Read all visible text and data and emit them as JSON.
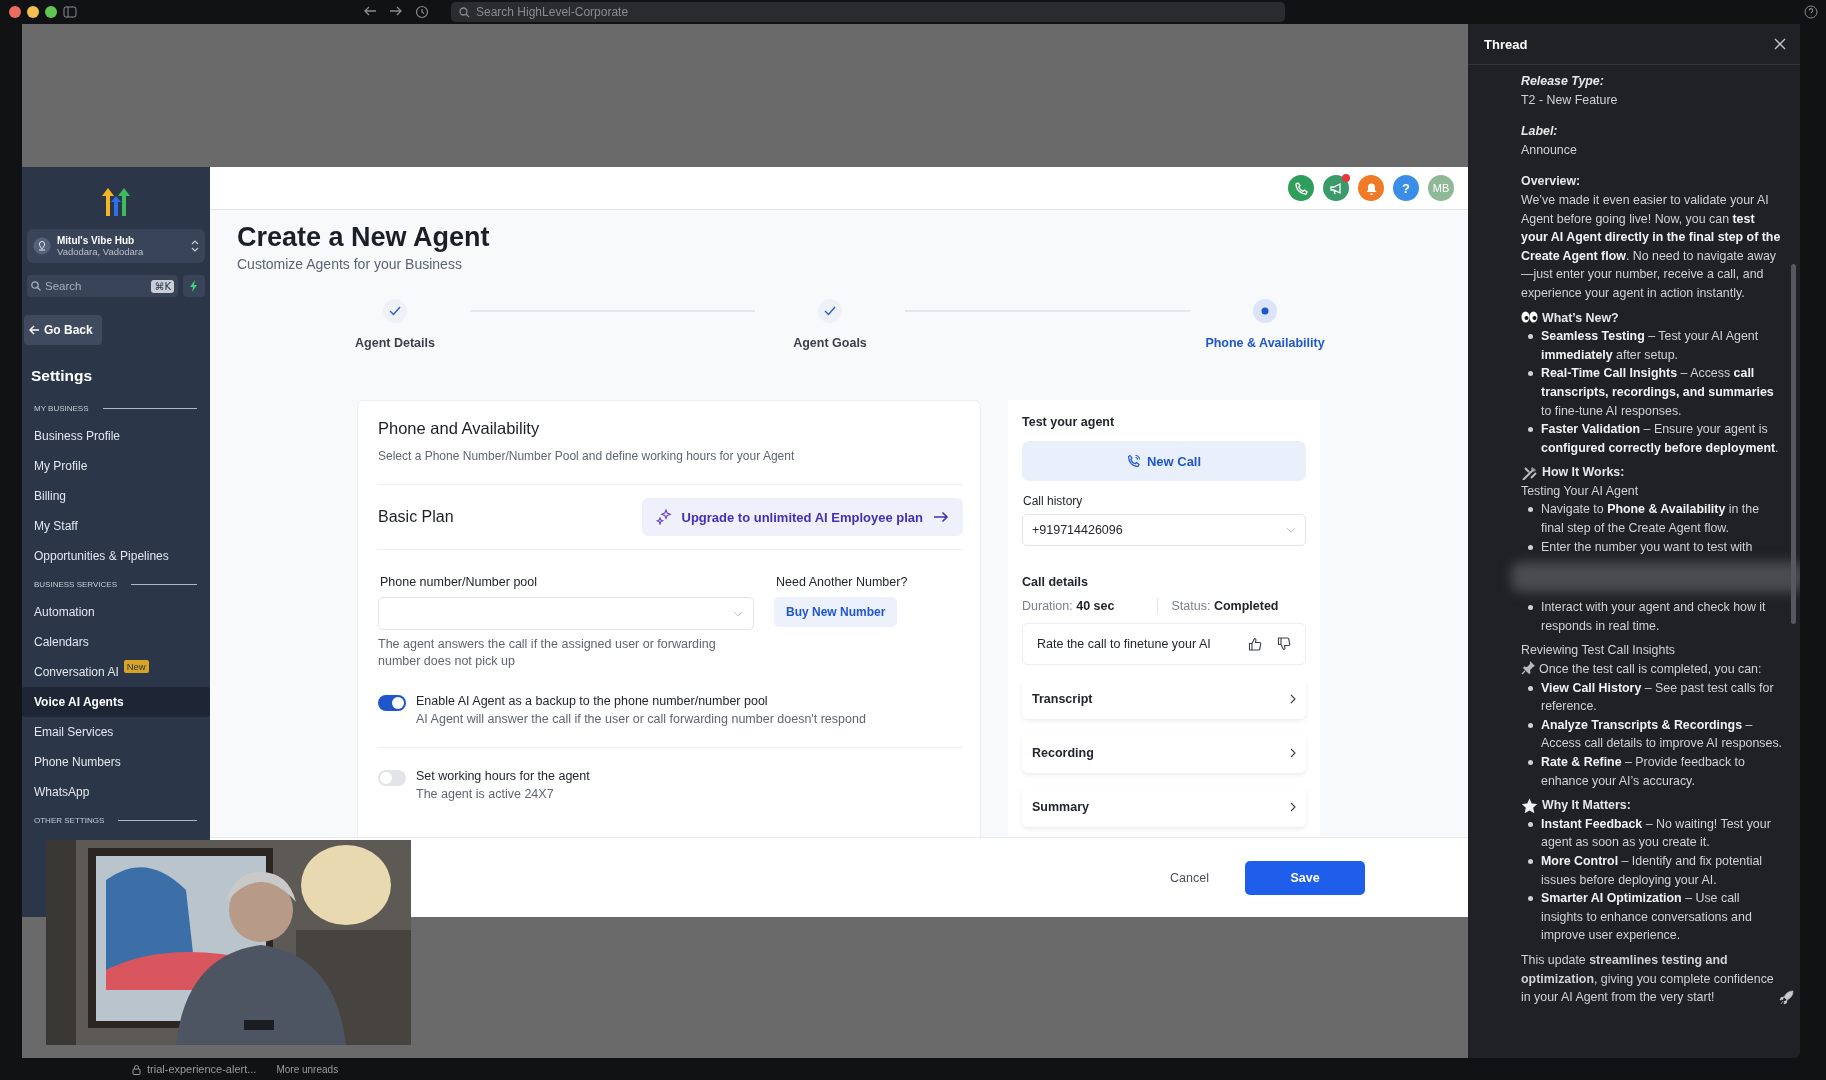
{
  "browser": {
    "search_placeholder": "Search HighLevel-Corporate"
  },
  "sidebar": {
    "account": {
      "name": "Mitul's Vibe Hub",
      "location": "Vadodara, Vadodara"
    },
    "search": {
      "placeholder": "Search",
      "shortcut": "⌘K"
    },
    "back_button": "Go Back",
    "title": "Settings",
    "sections": [
      {
        "label": "MY BUSINESS",
        "items": [
          {
            "label": "Business Profile",
            "selected": false
          },
          {
            "label": "My Profile",
            "selected": false
          },
          {
            "label": "Billing",
            "selected": false
          },
          {
            "label": "My Staff",
            "selected": false
          },
          {
            "label": "Opportunities & Pipelines",
            "selected": false
          }
        ]
      },
      {
        "label": "BUSINESS SERVICES",
        "items": [
          {
            "label": "Automation",
            "selected": false
          },
          {
            "label": "Calendars",
            "selected": false
          },
          {
            "label": "Conversation AI",
            "badge": "New",
            "selected": false
          },
          {
            "label": "Voice AI Agents",
            "selected": true
          },
          {
            "label": "Email Services",
            "selected": false
          },
          {
            "label": "Phone Numbers",
            "selected": false
          },
          {
            "label": "WhatsApp",
            "selected": false
          }
        ]
      },
      {
        "label": "OTHER SETTINGS"
      }
    ]
  },
  "header": {
    "help_label": "?",
    "avatar_initials": "MB"
  },
  "page": {
    "title": "Create a New Agent",
    "subtitle": "Customize Agents for your Business"
  },
  "steps": [
    {
      "label": "Agent Details",
      "completed": true,
      "selected": false
    },
    {
      "label": "Agent Goals",
      "completed": true,
      "selected": false
    },
    {
      "label": "Phone & Availability",
      "completed": false,
      "selected": true
    }
  ],
  "phone_card": {
    "title": "Phone and Availability",
    "description": "Select a Phone Number/Number Pool and define working hours for your Agent",
    "plan": "Basic Plan",
    "upgrade_button": "Upgrade to unlimited AI Employee plan",
    "number_field": {
      "label": "Phone number/Number pool",
      "help": "The agent answers the call if the assigned user or forwarding number does not pick up"
    },
    "another_number": {
      "label": "Need Another Number?",
      "button": "Buy New Number"
    },
    "toggles": [
      {
        "title": "Enable AI Agent as a backup to the phone number/number pool",
        "description": "AI Agent will answer the call if the user or call forwarding number doesn't respond",
        "on": true
      },
      {
        "title": "Set working hours for the agent",
        "description": "The agent is active 24X7",
        "on": false
      }
    ]
  },
  "test_panel": {
    "title": "Test your agent",
    "new_call_button": "New Call",
    "history_label": "Call history",
    "history_value": "+919714426096",
    "details_label": "Call details",
    "duration_label": "Duration:",
    "duration": "40 sec",
    "status_label": "Status:",
    "status": "Completed",
    "rate_text": "Rate the call to finetune your AI",
    "sections": [
      "Transcript",
      "Recording",
      "Summary"
    ]
  },
  "footer": {
    "buttons": [
      {
        "label": "Cancel",
        "kind": "secondary"
      },
      {
        "label": "Save",
        "kind": "primary"
      }
    ]
  },
  "thread": {
    "title": "Thread",
    "blocks": [
      {
        "kind": "field",
        "label": "Release Type:",
        "value": "T2 - New Feature"
      },
      {
        "kind": "field",
        "label": "Label:",
        "value": "Announce"
      },
      {
        "kind": "subheading",
        "text": "Overview:"
      },
      {
        "kind": "paragraph",
        "text": "We’ve made it even easier to validate your AI Agent before going live! Now, you can **test your AI Agent directly in the final step of the Create Agent flow**. No need to navigate away—just enter your number, receive a call, and experience your agent in action instantly."
      },
      {
        "kind": "heading",
        "text": "What’s New?"
      },
      {
        "kind": "bullets",
        "items": [
          "**Seamless Testing** – Test your AI Agent **immediately** after setup.",
          "**Real-Time Call Insights** – Access **call transcripts, recordings, and summaries** to fine-tune AI responses.",
          "**Faster Validation** – Ensure your agent is **configured correctly before deployment**."
        ]
      },
      {
        "kind": "heading",
        "text": "How It Works:"
      },
      {
        "kind": "plain",
        "text": "Testing Your AI Agent"
      },
      {
        "kind": "bullets",
        "items": [
          "Navigate to **Phone & Availability** in the final step of the Create Agent flow.",
          "Enter the number you want to test with"
        ]
      },
      {
        "kind": "redacted"
      },
      {
        "kind": "bullets",
        "items": [
          "Interact with your agent and check how it responds in real time."
        ]
      },
      {
        "kind": "plain",
        "text": "Reviewing Test Call Insights"
      },
      {
        "kind": "note",
        "text": "Once the test call is completed, you can:"
      },
      {
        "kind": "bullets",
        "items": [
          "**View Call History** – See past test calls for reference.",
          "**Analyze Transcripts & Recordings** – Access call details to improve AI responses.",
          "**Rate & Refine** – Provide feedback to enhance your AI’s accuracy."
        ]
      },
      {
        "kind": "heading",
        "text": "Why It Matters:"
      },
      {
        "kind": "bullets",
        "items": [
          "**Instant Feedback** – No waiting! Test your agent as soon as you create it.",
          "**More Control** – Identify and fix potential issues before deploying your AI.",
          "**Smarter AI Optimization** – Use call insights to enhance conversations and improve user experience."
        ]
      },
      {
        "kind": "closing",
        "text": "This update **streamlines testing and optimization**, giving you complete confidence in your AI Agent from the very start!"
      }
    ]
  },
  "bottom_bar": {
    "channel": "trial-experience-alert...",
    "unreads": "More unreads"
  }
}
